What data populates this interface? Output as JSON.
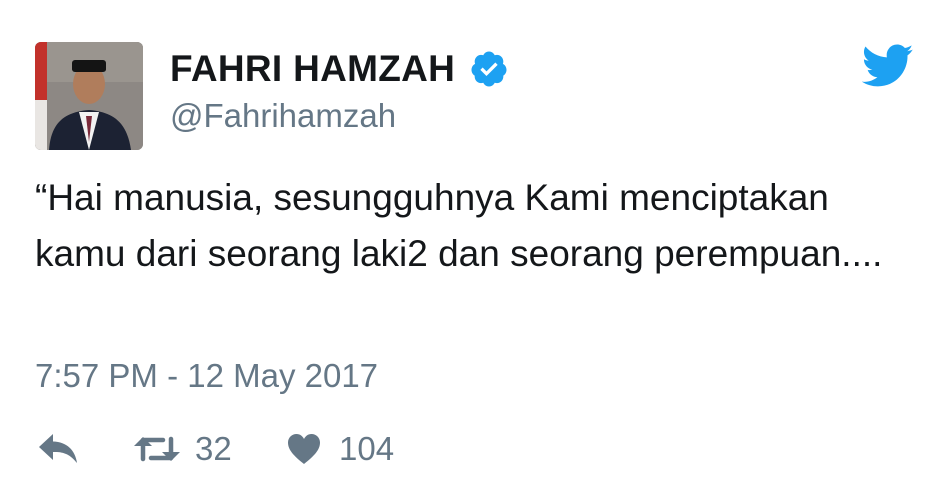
{
  "tweet": {
    "display_name": "FAHRI HAMZAH",
    "handle": "@Fahrihamzah",
    "verified": true,
    "avatar_icon": "profile-photo",
    "text": "“Hai manusia, sesungguhnya Kami menciptakan kamu dari seorang laki2 dan seorang perempuan....",
    "timestamp": "7:57 PM - 12 May 2017",
    "retweet_count": "32",
    "like_count": "104"
  },
  "icons": {
    "reply": "reply-icon",
    "retweet": "retweet-icon",
    "like": "heart-icon",
    "brand": "twitter-bird-icon",
    "verified": "verified-badge-icon"
  },
  "colors": {
    "brand_blue": "#1da1f2",
    "text": "#14171a",
    "secondary_text": "#657786"
  }
}
